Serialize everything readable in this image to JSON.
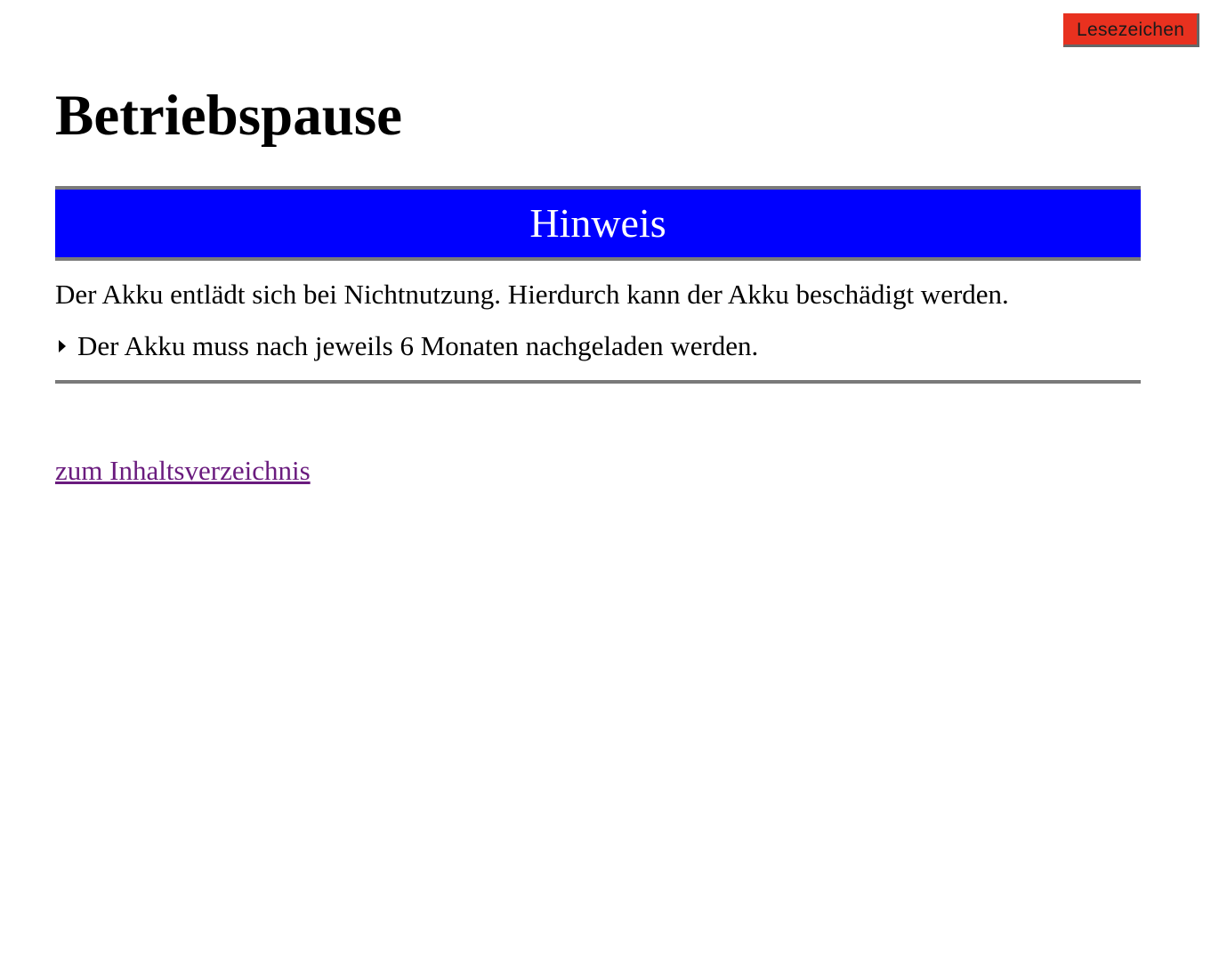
{
  "toolbar": {
    "bookmark_label": "Lesezeichen",
    "bookmark_color": "#e8311f"
  },
  "page": {
    "title": "Betriebspause"
  },
  "notice": {
    "heading": "Hinweis",
    "heading_background": "#0000ff",
    "text": "Der Akku entlädt sich bei Nichtnutzung. Hierdurch kann der Akku beschädigt werden.",
    "bullet_icon": "triangle-right-icon",
    "bullet_text": "Der Akku muss nach jeweils 6 Monaten nachgeladen werden."
  },
  "navigation": {
    "toc_link_label": "zum Inhaltsverzeichnis",
    "toc_link_color": "#6a1b7e"
  }
}
